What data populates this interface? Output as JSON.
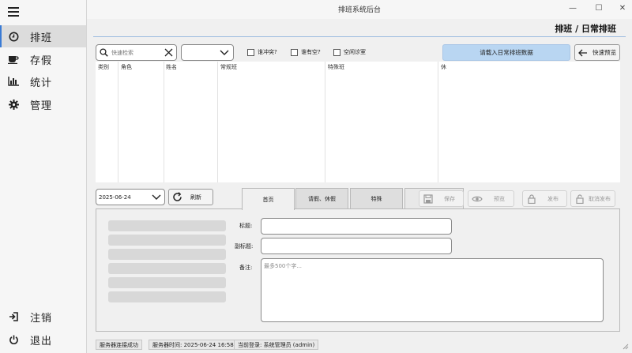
{
  "window": {
    "title": "排班系统后台",
    "minimize": "—",
    "maximize": "☐",
    "close": "✕"
  },
  "sidebar": {
    "items": [
      {
        "label": "排班",
        "icon": "clock-icon"
      },
      {
        "label": "存假",
        "icon": "cup-icon"
      },
      {
        "label": "统计",
        "icon": "bar-chart-icon"
      },
      {
        "label": "管理",
        "icon": "gear-icon"
      }
    ],
    "bottom": [
      {
        "label": "注销",
        "icon": "logout-icon"
      },
      {
        "label": "退出",
        "icon": "power-icon"
      }
    ]
  },
  "header": {
    "breadcrumb": "排班 / 日常排班"
  },
  "toolbar": {
    "search_placeholder": "快速检索",
    "select_value": "",
    "checks": [
      {
        "label": "谁冲突?"
      },
      {
        "label": "谁有空?"
      },
      {
        "label": "空闲诊室"
      }
    ],
    "load_label": "请载入日常排班数据",
    "back_label": "快速预览"
  },
  "table": {
    "columns": [
      "类别",
      "角色",
      "姓名",
      "常规班",
      "特殊班",
      "休"
    ]
  },
  "editor": {
    "date": "2025-06-24",
    "refresh_label": "刷新",
    "tabs": [
      "首页",
      "请假、休假",
      "特殊"
    ],
    "actions": [
      "保存",
      "预览",
      "发布",
      "取消发布"
    ],
    "fields": {
      "title": "标题:",
      "subtitle": "副标题:",
      "note": "备注:",
      "note_placeholder": "最多500个字..."
    }
  },
  "statusbar": {
    "connection": "服务器连接成功",
    "time": "服务器时间: 2025-06-24 16:58",
    "user": "当前登录: 系统管理员 (admin)"
  },
  "colors": {
    "accent": "#3a7bd5",
    "load_button": "#b9d6f2"
  }
}
